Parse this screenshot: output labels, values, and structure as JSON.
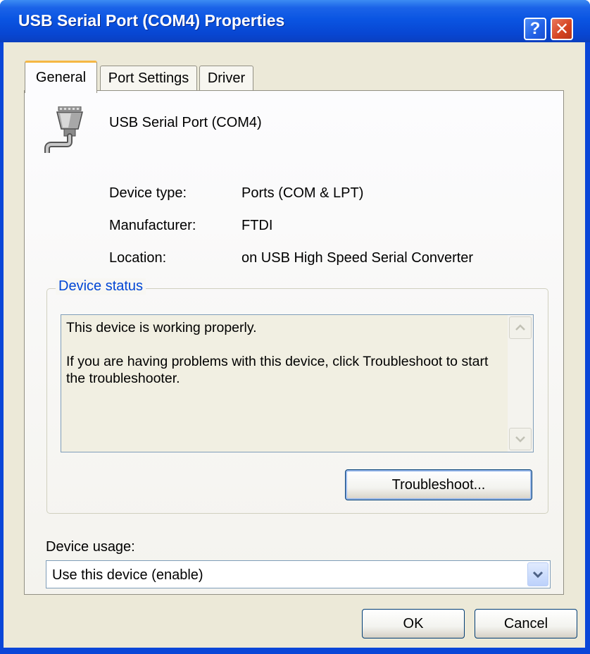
{
  "window": {
    "title": "USB Serial Port (COM4) Properties",
    "help_symbol": "?",
    "close_symbol": "✕"
  },
  "tabs": [
    {
      "label": "General",
      "active": true
    },
    {
      "label": "Port Settings",
      "active": false
    },
    {
      "label": "Driver",
      "active": false
    }
  ],
  "device": {
    "icon": "serial-port-icon",
    "name": "USB Serial Port (COM4)"
  },
  "properties": [
    {
      "label": "Device type:",
      "value": "Ports (COM & LPT)"
    },
    {
      "label": "Manufacturer:",
      "value": "FTDI"
    },
    {
      "label": "Location:",
      "value": "on USB High Speed Serial Converter"
    }
  ],
  "device_status": {
    "title": "Device status",
    "line1": "This device is working properly.",
    "line2": "If you are having problems with this device, click Troubleshoot to start the troubleshooter.",
    "troubleshoot_label": "Troubleshoot..."
  },
  "device_usage": {
    "label": "Device usage:",
    "selected": "Use this device (enable)"
  },
  "footer": {
    "ok_label": "OK",
    "cancel_label": "Cancel"
  },
  "colors": {
    "titlebar": "#0a55e2",
    "dialog_bg": "#ece9d8",
    "group_title": "#0046d5",
    "active_tab_highlight": "#f5b744"
  }
}
